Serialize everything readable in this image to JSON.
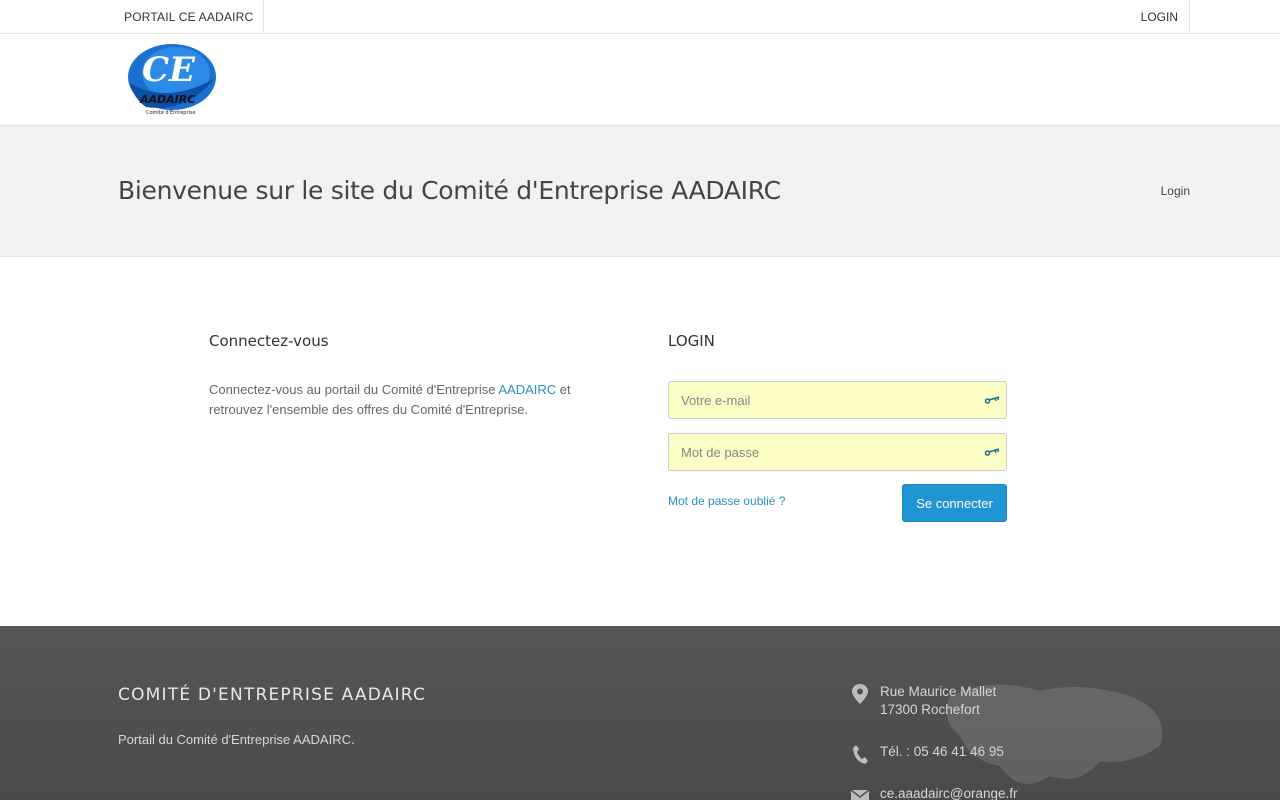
{
  "topbar": {
    "portal_label": "PORTAIL CE AADAIRC",
    "login_label": "LOGIN"
  },
  "logo": {
    "big": "CE",
    "name": "AADAIRC",
    "tagline": "Comité d'Entreprise"
  },
  "page": {
    "title": "Bienvenue sur le site du Comité d'Entreprise AADAIRC",
    "breadcrumb": "Login"
  },
  "intro": {
    "heading": "Connectez-vous",
    "text_before": "Connectez-vous au portail du Comité d'Entreprise ",
    "link": "AADAIRC",
    "text_after": " et retrouvez l'ensemble des offres du Comité d'Entreprise."
  },
  "login_form": {
    "heading": "LOGIN",
    "email_placeholder": "Votre e-mail",
    "password_placeholder": "Mot de passe",
    "forgot": "Mot de passe oublié ?",
    "submit": "Se connecter"
  },
  "footer": {
    "title": "COMITÉ D'ENTREPRISE AADAIRC",
    "description": "Portail du Comité d'Entreprise AADAIRC.",
    "address_line1": "Rue Maurice Mallet",
    "address_line2": "17300 Rochefort",
    "phone": "Tél. : 05 46 41 46 95",
    "email": "ce.aaadairc@orange.fr"
  },
  "icons": {
    "field": "key-icon",
    "address": "map-pin-icon",
    "phone": "phone-icon",
    "email": "envelope-icon"
  },
  "colors": {
    "accent": "#1f95d3",
    "link": "#2d8fc9",
    "autofill": "#fdfdc6",
    "footer": "#505050"
  }
}
